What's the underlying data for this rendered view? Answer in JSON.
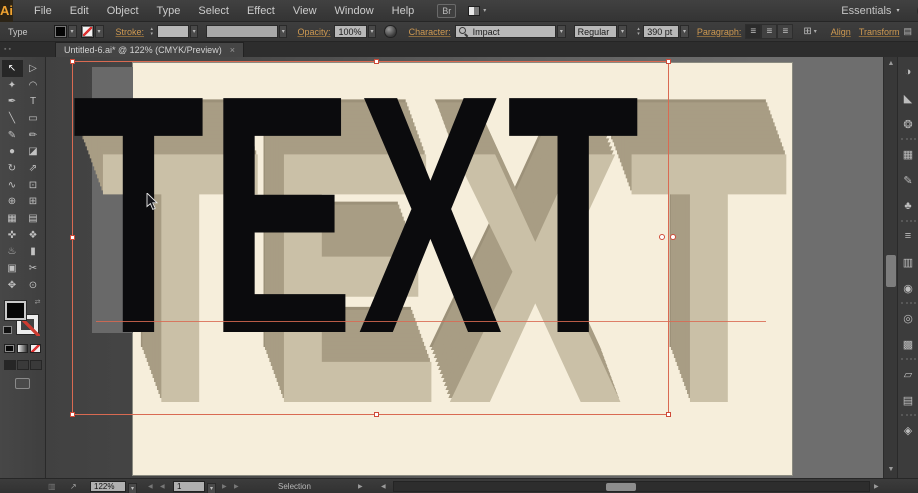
{
  "titlebar": {
    "logo": "Ai",
    "menus": [
      {
        "label": "File"
      },
      {
        "label": "Edit"
      },
      {
        "label": "Object"
      },
      {
        "label": "Type"
      },
      {
        "label": "Select"
      },
      {
        "label": "Effect"
      },
      {
        "label": "View"
      },
      {
        "label": "Window"
      },
      {
        "label": "Help"
      }
    ],
    "br_button": "Br",
    "workspace_value": "Essentials",
    "search_placeholder": "",
    "window": {
      "minimize": "–",
      "restore": "❐",
      "close": "×"
    }
  },
  "controlbar": {
    "selection_label": "Type",
    "stroke_label": "Stroke:",
    "opacity_label": "Opacity:",
    "opacity_value": "100%",
    "character_label": "Character:",
    "font_value": "Impact",
    "style_value": "Regular",
    "size_value": "390 pt",
    "paragraph_label": "Paragraph:",
    "align_glyph": "≡",
    "align_link": "Align",
    "transform_link": "Transform",
    "warp_glyph": "⊞",
    "panel_menu_glyph": "▤"
  },
  "tabbar": {
    "dock_head_glyph": "▪▪",
    "tab_title": "Untitled-6.ai* @ 122% (CMYK/Preview)",
    "close_glyph": "×"
  },
  "tools": [
    {
      "name": "selection",
      "glyph": "↖"
    },
    {
      "name": "direct-selection",
      "glyph": "▷"
    },
    {
      "name": "magic-wand",
      "glyph": "✦"
    },
    {
      "name": "lasso",
      "glyph": "◠"
    },
    {
      "name": "pen",
      "glyph": "✒"
    },
    {
      "name": "type",
      "glyph": "T"
    },
    {
      "name": "line-segment",
      "glyph": "╲"
    },
    {
      "name": "rectangle",
      "glyph": "▭"
    },
    {
      "name": "paintbrush",
      "glyph": "✎"
    },
    {
      "name": "pencil",
      "glyph": "✏"
    },
    {
      "name": "blob-brush",
      "glyph": "●"
    },
    {
      "name": "eraser",
      "glyph": "◪"
    },
    {
      "name": "rotate",
      "glyph": "↻"
    },
    {
      "name": "scale",
      "glyph": "⇗"
    },
    {
      "name": "width",
      "glyph": "∿"
    },
    {
      "name": "free-transform",
      "glyph": "⊡"
    },
    {
      "name": "shape-builder",
      "glyph": "⊕"
    },
    {
      "name": "perspective-grid",
      "glyph": "⊞"
    },
    {
      "name": "mesh",
      "glyph": "▦"
    },
    {
      "name": "gradient",
      "glyph": "▤"
    },
    {
      "name": "eyedropper",
      "glyph": "✜"
    },
    {
      "name": "blend",
      "glyph": "❖"
    },
    {
      "name": "symbol-sprayer",
      "glyph": "♨"
    },
    {
      "name": "column-graph",
      "glyph": "▮"
    },
    {
      "name": "artboard",
      "glyph": "▣"
    },
    {
      "name": "slice",
      "glyph": "✂"
    },
    {
      "name": "hand",
      "glyph": "✥"
    },
    {
      "name": "zoom",
      "glyph": "⊙"
    }
  ],
  "toolbar_extras": {
    "swap_glyph": "⇄",
    "mode_glyphs": [
      "▣",
      "◰",
      "◱"
    ]
  },
  "panels": [
    {
      "name": "color",
      "glyph": "◑"
    },
    {
      "name": "color-guide",
      "glyph": "◣"
    },
    {
      "name": "color-themes",
      "glyph": "❂"
    },
    {
      "name": "swatches",
      "glyph": "▦"
    },
    {
      "name": "brushes",
      "glyph": "✎"
    },
    {
      "name": "symbols",
      "glyph": "♣"
    },
    {
      "name": "stroke",
      "glyph": "≡"
    },
    {
      "name": "gradient",
      "glyph": "▥"
    },
    {
      "name": "transparency",
      "glyph": "◉"
    },
    {
      "name": "appearance",
      "glyph": "◎"
    },
    {
      "name": "graphic-styles",
      "glyph": "▩"
    },
    {
      "name": "layers",
      "glyph": "▱"
    },
    {
      "name": "artboards",
      "glyph": "▤"
    },
    {
      "name": "asset-export",
      "glyph": "◈"
    }
  ],
  "canvas": {
    "word": "TEXT"
  },
  "colors": {
    "accent_label_orange": "#cf9a52",
    "selection_red": "#d96a52",
    "artboard_cream": "#f6eedb",
    "front_text_black": "#0b0b0d",
    "back_face_tan": "#cac0a7",
    "bevel_tan": "#a89d84",
    "pasteboard_gray_left": "#454545",
    "pasteboard_gray_right": "#6e6e6e"
  },
  "statusbar": {
    "zoom_value": "122%",
    "artboard_value": "1",
    "status_label": "Selection"
  },
  "glyphs": {
    "dropdown": "▾",
    "spin_up": "▴",
    "spin_down": "▾",
    "left": "◀",
    "right": "▶",
    "up": "▲",
    "down": "▼",
    "export": "↗",
    "placeholder_icon": "▥"
  }
}
